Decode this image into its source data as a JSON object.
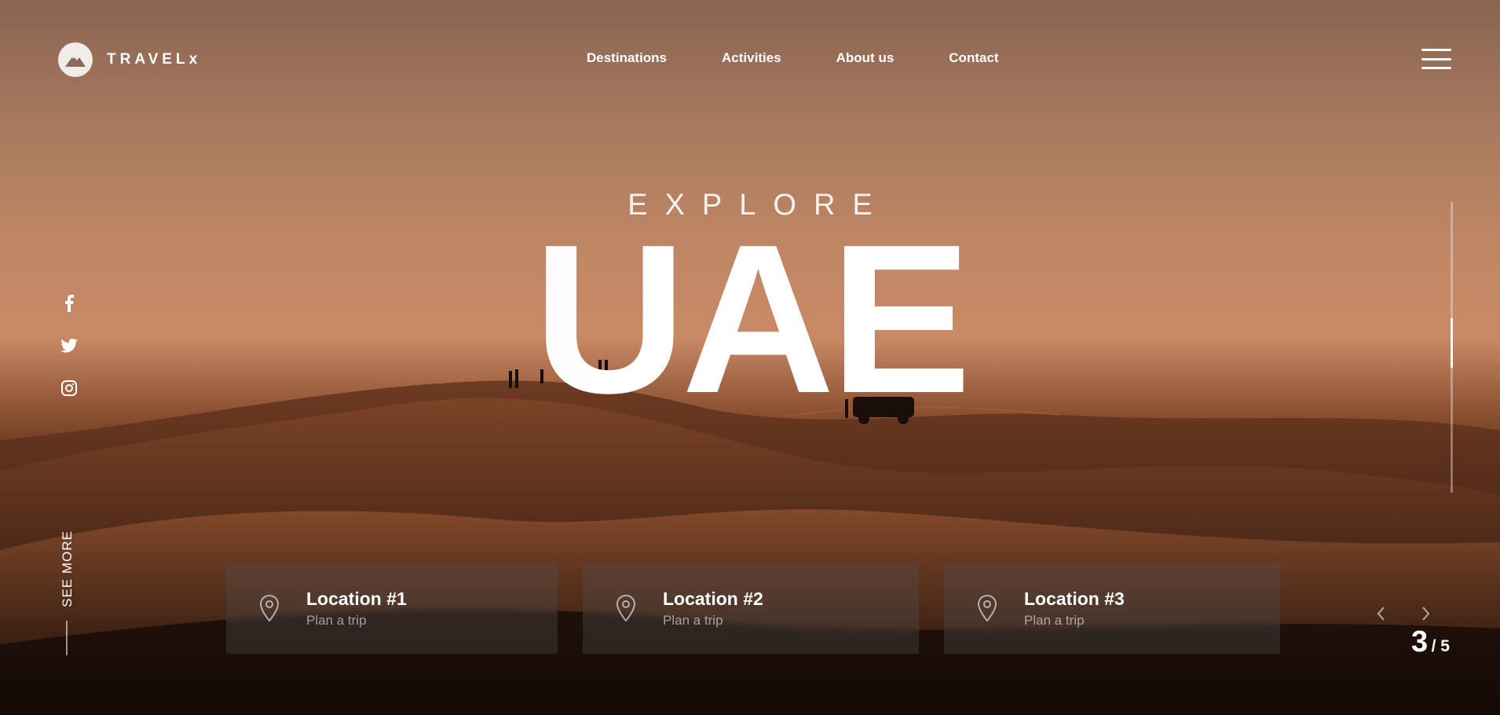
{
  "brand": {
    "name": "TRAVELx"
  },
  "nav": {
    "items": [
      "Destinations",
      "Activities",
      "About us",
      "Contact"
    ]
  },
  "hero": {
    "eyebrow": "EXPLORE",
    "title": "UAE"
  },
  "side": {
    "see_more": "SEE MORE"
  },
  "social": [
    "facebook-icon",
    "twitter-icon",
    "instagram-icon"
  ],
  "cards": [
    {
      "title": "Location #1",
      "subtitle": "Plan a trip"
    },
    {
      "title": "Location #2",
      "subtitle": "Plan a trip"
    },
    {
      "title": "Location #3",
      "subtitle": "Plan a trip"
    }
  ],
  "pager": {
    "current": "3",
    "total": "/ 5"
  },
  "slides": {
    "current": 3,
    "total": 5
  },
  "colors": {
    "accent": "#ffffff",
    "sky": "#c98a66",
    "dune_dark": "#1c0f0a"
  }
}
